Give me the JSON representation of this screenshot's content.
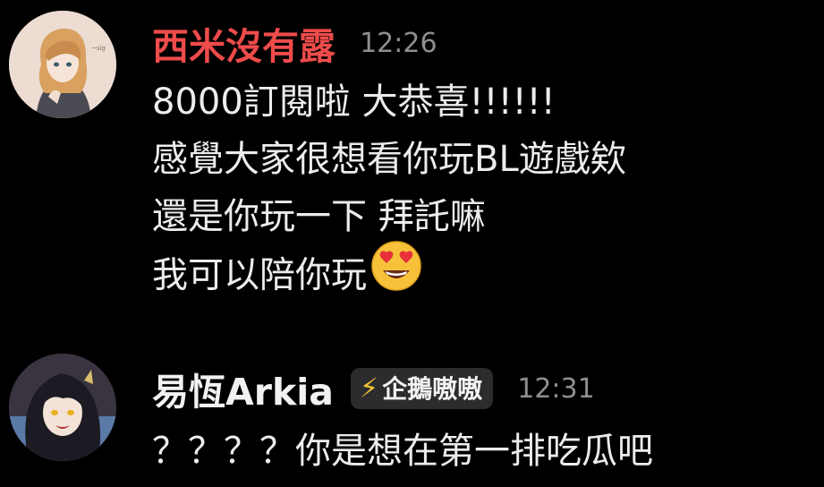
{
  "messages": [
    {
      "username": "西米沒有露",
      "username_color": "#ee4b4b",
      "time": "12:26",
      "lines": [
        "8000訂閱啦 大恭喜!!!!!!",
        "感覺大家很想看你玩BL遊戲欸",
        "還是你玩一下 拜託嘛",
        "我可以陪你玩"
      ],
      "emoji": "heart-eyes-emoji"
    },
    {
      "username": "易恆Arkia",
      "username_color": "#f2f2f2",
      "badge": {
        "icon": "lightning-icon",
        "icon_glyph": "⚡",
        "label": "企鵝嗷嗷"
      },
      "time": "12:31",
      "lines": [
        "？？？？你是想在第一排吃瓜吧"
      ]
    }
  ]
}
